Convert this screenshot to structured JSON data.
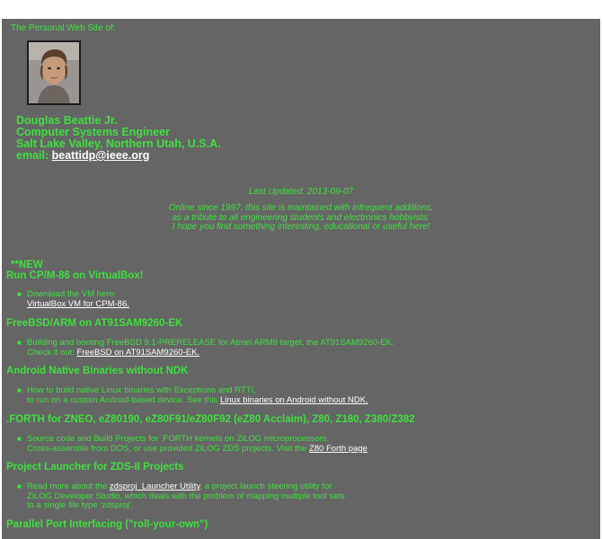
{
  "header": {
    "tagline": "The Personal Web Site of:",
    "name": "Douglas Beattie Jr.",
    "role": "Computer Systems Engineer",
    "location": "Salt Lake Valley, Northern Utah, U.S.A.",
    "email_label": "email:",
    "email": "beattidp@ieee.org"
  },
  "updated": "Last Updated: 2013-09-07",
  "intro": [
    "Online since 1997, this site is maintained with infrequent additions,",
    "as a tribute to all engineering students and electronics hobbyists.",
    "I hope you find something interesting, educational or useful here!"
  ],
  "new_flag": "**NEW",
  "sections": [
    {
      "title": "Run CP/M-86 on VirtualBox!",
      "line1": "Download the VM here:",
      "line2_pre": "",
      "link": "VirtualBox VM for CPM-86.",
      "line2_post": "",
      "line3": ""
    },
    {
      "title": "FreeBSD/ARM on AT91SAM9260-EK",
      "line1": "Building and booting FreeBSD 9.1-PRERELEASE for Atmel ARM9 target, the AT91SAM9260-EK.",
      "line2_pre": "Check it out: ",
      "link": "FreeBSD on AT91SAM9260-EK.",
      "line2_post": "",
      "line3": ""
    },
    {
      "title": "Android Native Binaries without NDK",
      "line1": "How to build native Linux binaries with Exceptions and RTTI,",
      "line2_pre": "to run on a custom Android-based device. See this ",
      "link": "Linux binaries on Android without NDK.",
      "line2_post": "",
      "line3": ""
    },
    {
      "title": ".FORTH for ZNEO, eZ80190, eZ80F91/eZ80F92 (eZ80 Acclaim), Z80, Z180, Z380/Z382",
      "line1": "Source code and Build Projects for .FORTH kernels on ZiLOG microprocessors.",
      "line2_pre": "Cross-assemble from DOS, or use provided ZiLOG ZDS projects. Visit the ",
      "link": "Z80 Forth page",
      "line2_post": "",
      "line3": ""
    },
    {
      "title": "Project Launcher for ZDS-II Projects",
      "line1_pre": "Read more about the ",
      "line1_link": "zdsproj_Launcher Utility",
      "line1_post": ", a project launch steering utility for",
      "line2_pre": "ZiLOG Developer Studio, which deals with the problem of mapping multiple tool sets",
      "link": "",
      "line2_post": "",
      "line3": "to a single file type 'zdsproj'."
    },
    {
      "title": "Parallel Port Interfacing (\"roll-your-own\")"
    }
  ]
}
